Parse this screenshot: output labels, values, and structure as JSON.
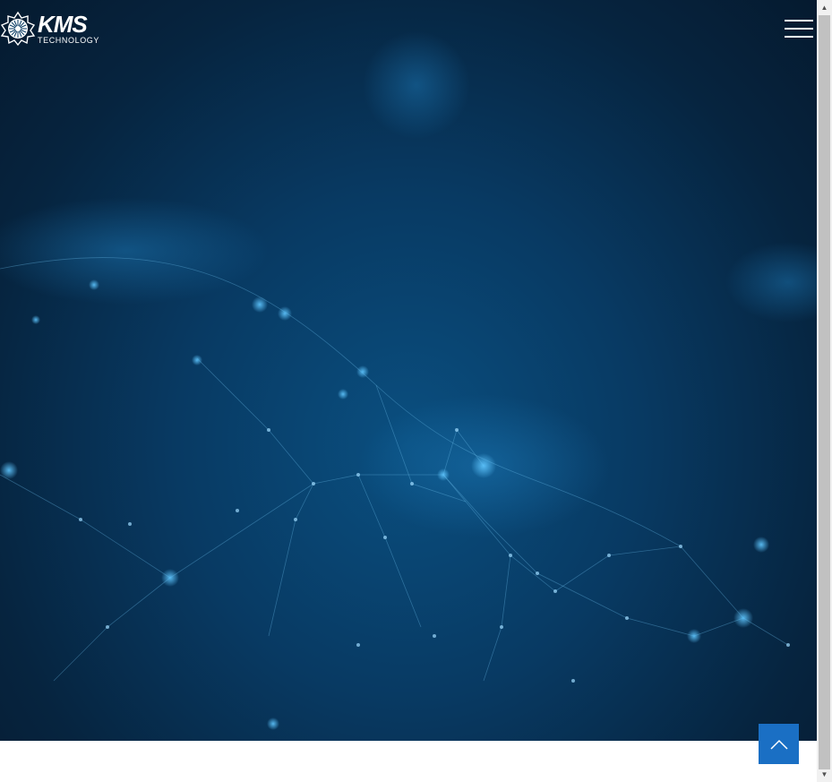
{
  "header": {
    "logo": {
      "main_text": "KMS",
      "sub_text": "TECHNOLOGY"
    },
    "menu_icon": "hamburger-menu-icon"
  },
  "scroll_top": {
    "icon": "chevron-up-icon",
    "color": "#1a6fc4"
  },
  "scrollbar": {
    "up_glyph": "▲",
    "down_glyph": "▼"
  },
  "colors": {
    "hero_dark": "#051a2f",
    "hero_mid": "#083a63",
    "hero_light": "#0a4f80",
    "node": "#4fb3e8"
  }
}
